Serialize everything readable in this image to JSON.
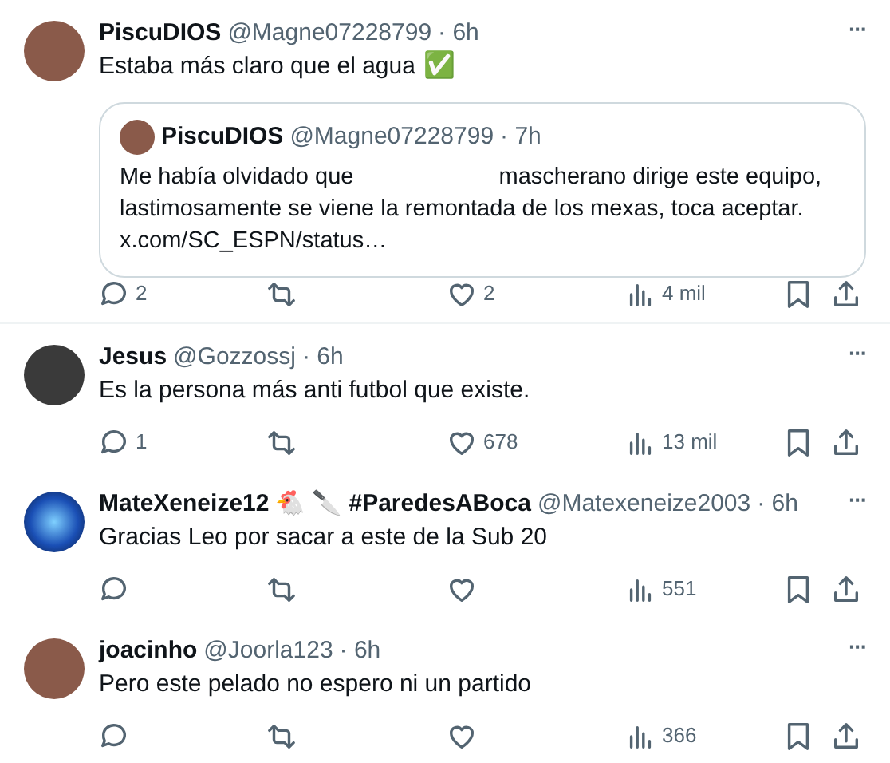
{
  "posts": [
    {
      "name": "PiscuDIOS",
      "handle": "@Magne07228799",
      "time": "· 6h",
      "text": "Estaba más claro que el agua",
      "emoji": "✅",
      "more": "···",
      "quote": {
        "name": "PiscuDIOS",
        "handle": "@Magne07228799",
        "time": "· 7h",
        "text_before": "Me había olvidado que",
        "text_after": "mascherano dirige este equipo, lastimosamente se viene la remontada de los mexas, toca aceptar.",
        "link": "x.com/SC_ESPN/status…"
      },
      "actions": [
        {
          "kind": "reply",
          "count": "2"
        },
        {
          "kind": "repost"
        },
        {
          "kind": "like",
          "count": "2"
        },
        {
          "kind": "views",
          "count": "4 mil"
        },
        {
          "kind": "bookmark"
        },
        {
          "kind": "share"
        }
      ]
    },
    {
      "name": "Jesus",
      "handle": "@Gozzossj",
      "time": "· 6h",
      "text": "Es la persona más anti futbol que existe.",
      "more": "···",
      "actions": [
        {
          "kind": "reply",
          "count": "1"
        },
        {
          "kind": "repost"
        },
        {
          "kind": "like",
          "count": "678"
        },
        {
          "kind": "views",
          "count": "13 mil"
        },
        {
          "kind": "bookmark"
        },
        {
          "kind": "share"
        }
      ]
    },
    {
      "name": "MateXeneize12",
      "name_emoji": [
        "🐔",
        "🔪"
      ],
      "hashtag": "#ParedesABoca",
      "handle": "@Matexeneize2003",
      "time": "· 6h",
      "text": "Gracias Leo por sacar a este de la Sub 20",
      "more": "···",
      "actions": [
        {
          "kind": "reply"
        },
        {
          "kind": "repost"
        },
        {
          "kind": "like"
        },
        {
          "kind": "views",
          "count": "551"
        },
        {
          "kind": "bookmark"
        },
        {
          "kind": "share"
        }
      ]
    },
    {
      "name": "joacinho",
      "handle": "@Joorla123",
      "time": "· 6h",
      "text": "Pero este pelado no espero ni un partido",
      "more": "···",
      "actions": [
        {
          "kind": "reply"
        },
        {
          "kind": "repost"
        },
        {
          "kind": "like"
        },
        {
          "kind": "views",
          "count": "366"
        },
        {
          "kind": "bookmark"
        },
        {
          "kind": "share"
        }
      ]
    }
  ]
}
